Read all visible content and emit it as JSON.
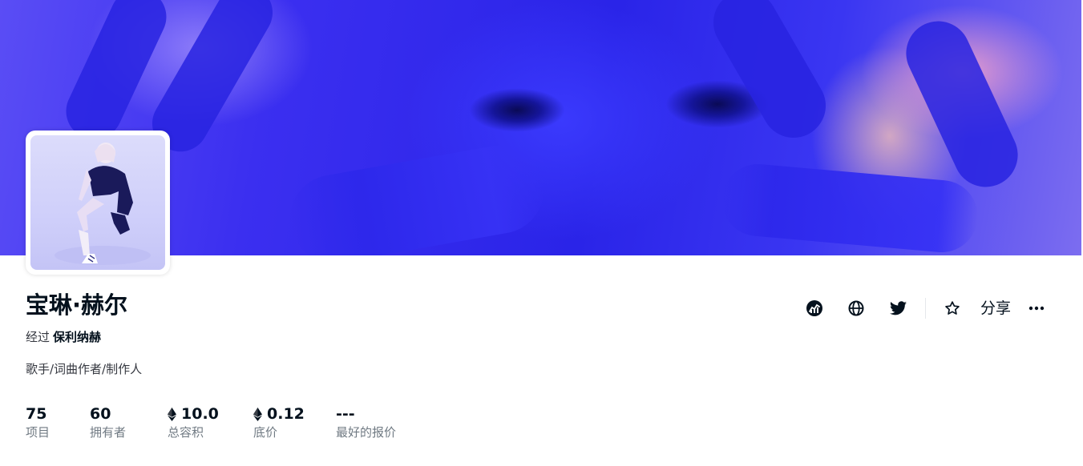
{
  "collection": {
    "title": "宝琳·赫尔",
    "creator_prefix": "经过",
    "creator_name": "保利纳赫",
    "description": "歌手/词曲作者/制作人"
  },
  "stats": [
    {
      "value": "75",
      "label": "项目",
      "icon": ""
    },
    {
      "value": "60",
      "label": "拥有者",
      "icon": ""
    },
    {
      "value": "10.0",
      "label": "总容积",
      "icon": "eth-icon"
    },
    {
      "value": "0.12",
      "label": "底价",
      "icon": "eth-icon"
    },
    {
      "value": "---",
      "label": "最好的报价",
      "icon": ""
    }
  ],
  "actions": {
    "share_label": "分享",
    "icons": [
      "activity-chart-icon",
      "globe-icon",
      "twitter-icon",
      "star-icon",
      "more-icon"
    ]
  },
  "colors": {
    "text_primary": "#04111d",
    "text_secondary": "#707a83",
    "banner_blue": "#2a24e8"
  }
}
